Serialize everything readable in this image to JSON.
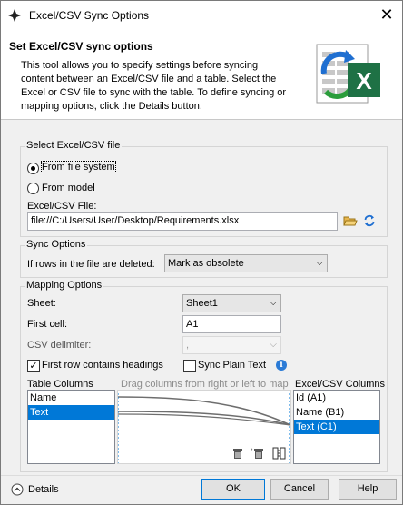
{
  "window": {
    "title": "Excel/CSV Sync Options",
    "close_glyph": "✕"
  },
  "header": {
    "title": "Set Excel/CSV sync options",
    "description": "This tool allows you to specify settings before syncing content between an Excel/CSV file and a table. Select the Excel or CSV file to sync with the table. To define syncing or mapping options, click the Details button."
  },
  "select_file": {
    "group_title": "Select Excel/CSV file",
    "option_file_system": "From file system",
    "option_model": "From model",
    "selected": "From file system",
    "file_label": "Excel/CSV File:",
    "file_value": "file://C:/Users/User/Desktop/Requirements.xlsx"
  },
  "sync_options": {
    "group_title": "Sync Options",
    "deleted_label": "If rows in the file are deleted:",
    "deleted_value": "Mark as obsolete"
  },
  "mapping": {
    "group_title": "Mapping Options",
    "sheet_label": "Sheet:",
    "sheet_value": "Sheet1",
    "first_cell_label": "First cell:",
    "first_cell_value": "A1",
    "csv_delim_label": "CSV delimiter:",
    "csv_delim_value": ",",
    "first_row_headings_label": "First row contains headings",
    "first_row_headings_checked": true,
    "sync_plain_text_label": "Sync Plain Text",
    "sync_plain_text_checked": false,
    "table_columns_label": "Table Columns",
    "table_columns": [
      "Name",
      "Text"
    ],
    "table_columns_selected": "Text",
    "drag_hint": "Drag columns from right or left to map",
    "excel_columns_label": "Excel/CSV Columns",
    "excel_columns": [
      "Id (A1)",
      "Name (B1)",
      "Text (C1)"
    ],
    "excel_columns_selected": "Text (C1)"
  },
  "footer": {
    "details_label": "Details",
    "ok_label": "OK",
    "cancel_label": "Cancel",
    "help_label": "Help"
  },
  "colors": {
    "selection": "#0078d7",
    "excel_green": "#1e7145",
    "sync_blue": "#1f6fd1"
  }
}
